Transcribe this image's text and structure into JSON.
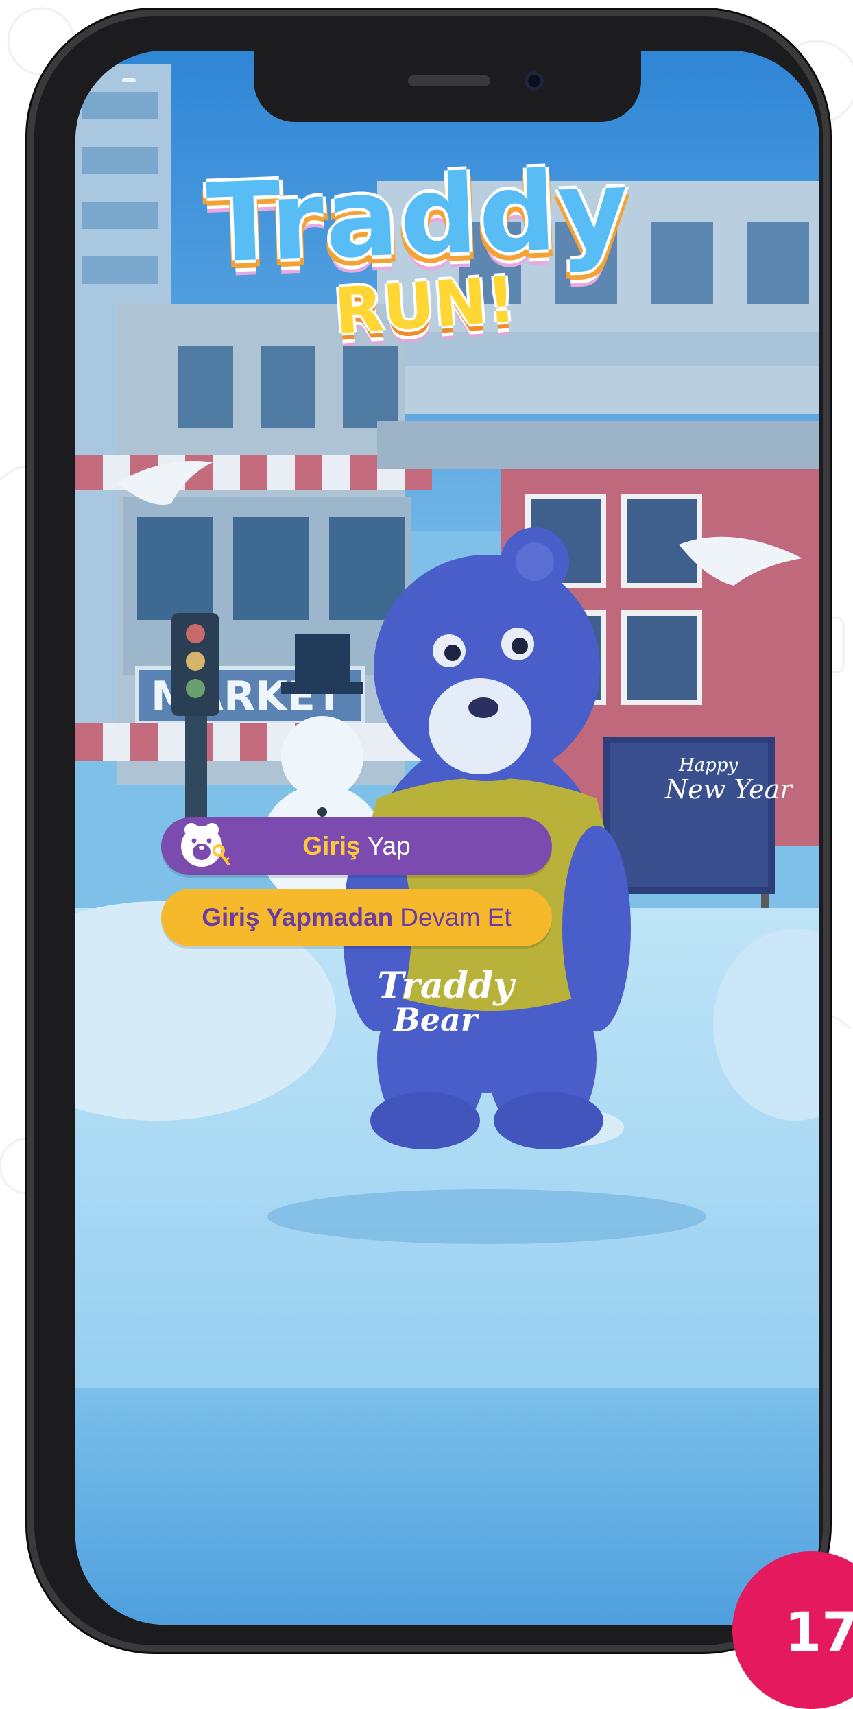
{
  "logo": {
    "title": "Traddy",
    "subtitle": "RUN!"
  },
  "scene": {
    "market_sign": "MARKET",
    "billboard_top": "Happy",
    "billboard_bottom": "New Year"
  },
  "buttons": {
    "login": {
      "bold": "Giriş",
      "regular": "Yap"
    },
    "guest": {
      "bold": "Giriş Yapmadan",
      "regular": "Devam Et"
    }
  },
  "brand": {
    "line1": "Traddy",
    "line2": "Bear"
  },
  "page_number": "17",
  "colors": {
    "login": "#7b4bb0",
    "guest": "#f6b92c",
    "badge": "#e5195d",
    "bear": "#4a5ec9",
    "shirt": "#b8b23a"
  }
}
